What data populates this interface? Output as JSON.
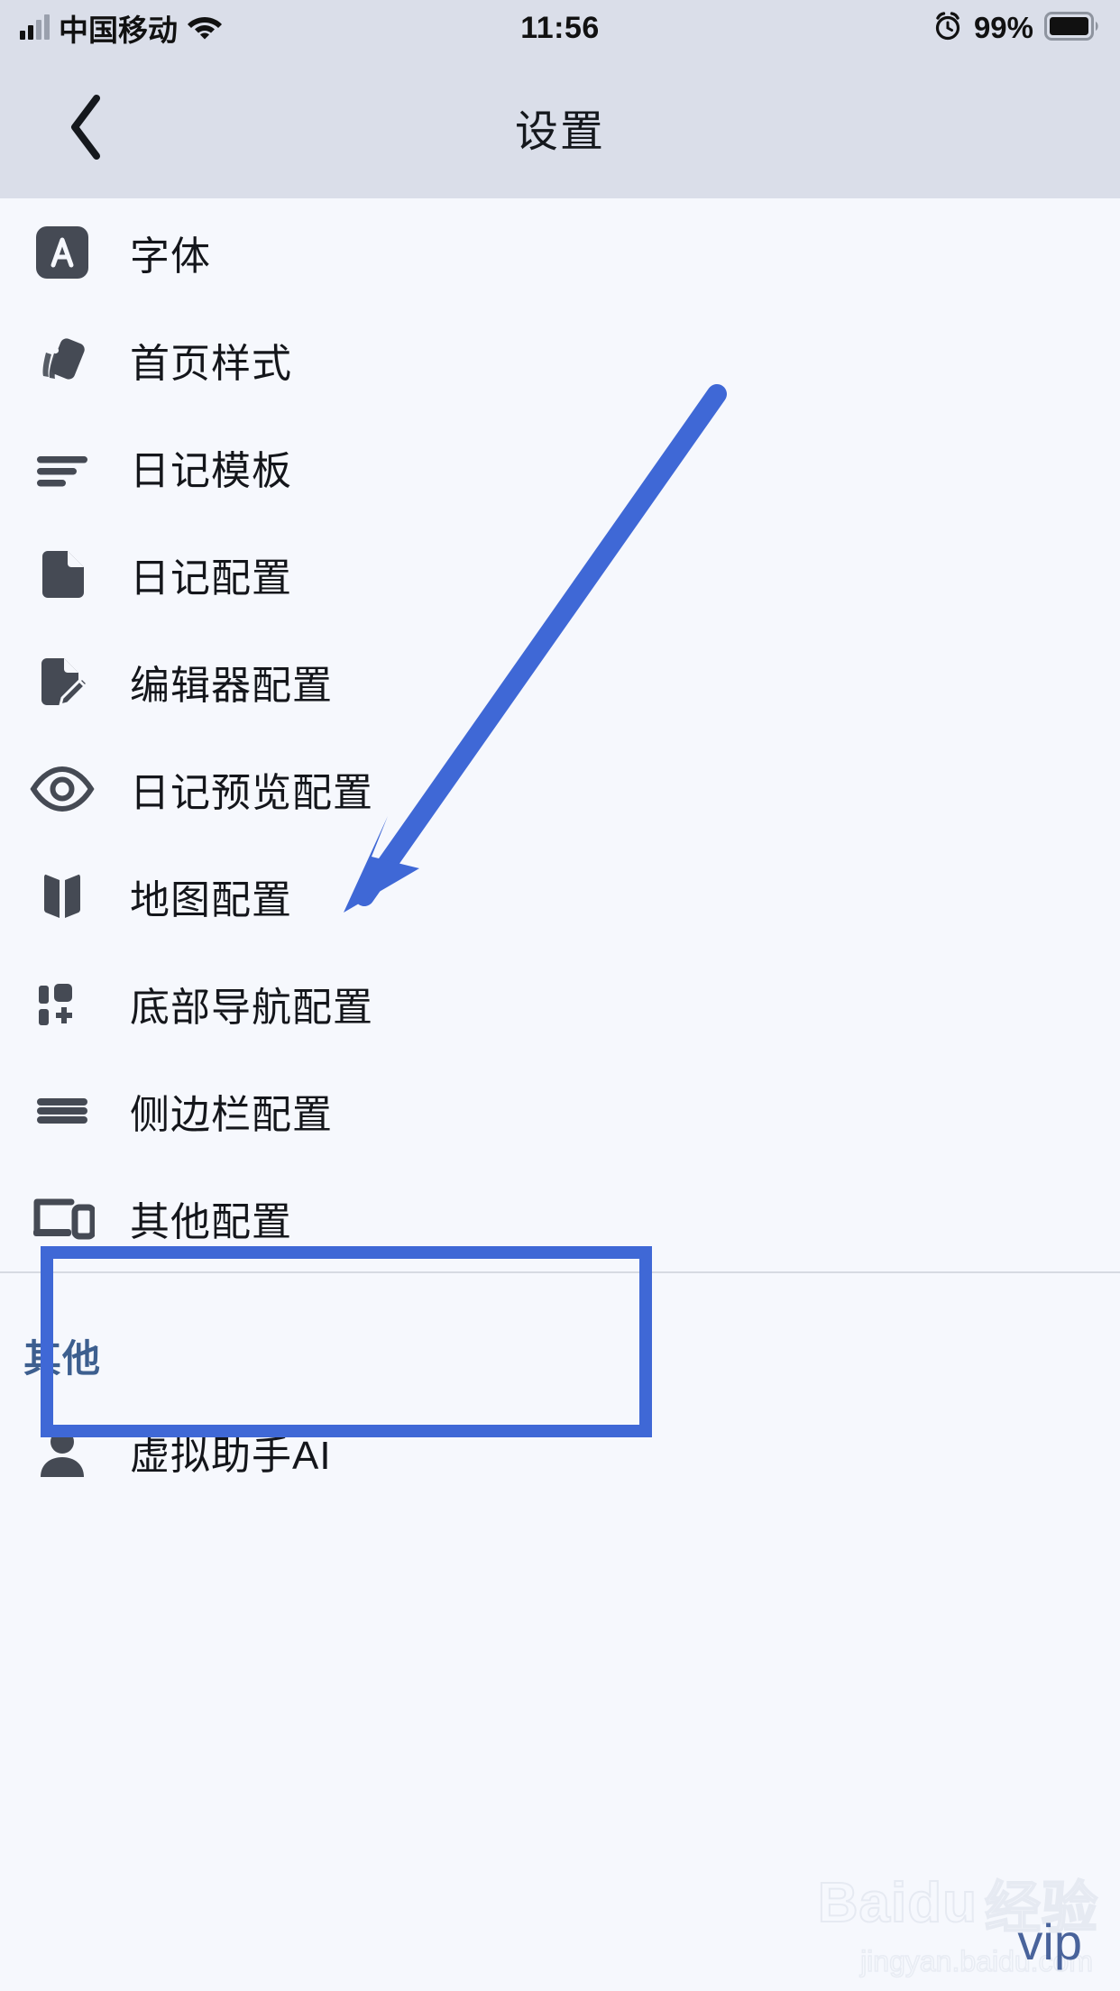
{
  "status_bar": {
    "carrier": "中国移动",
    "time": "11:56",
    "battery_percent": "99%",
    "wifi_icon": "wifi-icon",
    "alarm_icon": "alarm-icon",
    "signal_icon": "signal-bars-icon",
    "battery_icon": "battery-icon"
  },
  "header": {
    "title": "设置",
    "back_icon": "chevron-left-icon"
  },
  "list": {
    "items": [
      {
        "label": "字体",
        "icon": "font-letter-a-icon"
      },
      {
        "label": "首页样式",
        "icon": "cards-style-icon"
      },
      {
        "label": "日记模板",
        "icon": "align-left-lines-icon"
      },
      {
        "label": "日记配置",
        "icon": "document-icon"
      },
      {
        "label": "编辑器配置",
        "icon": "document-pencil-icon"
      },
      {
        "label": "日记预览配置",
        "icon": "eye-icon"
      },
      {
        "label": "地图配置",
        "icon": "map-icon"
      },
      {
        "label": "底部导航配置",
        "icon": "grid-plus-icon"
      },
      {
        "label": "侧边栏配置",
        "icon": "hamburger-menu-icon"
      },
      {
        "label": "其他配置",
        "icon": "laptop-phone-icon"
      }
    ]
  },
  "other_section": {
    "title": "其他",
    "items": [
      {
        "label": "虚拟助手AI",
        "icon": "person-icon"
      }
    ]
  },
  "annotations": {
    "highlight_color": "#3f68d6",
    "highlighted_item": "底部导航配置",
    "arrow_icon": "arrow-pointer-icon"
  },
  "watermark": {
    "brand": "Baidu",
    "brand_cn": "经验",
    "url": "jingyan.baidu.com",
    "badge": "vip"
  },
  "colors": {
    "page_bg": "#f6f8fd",
    "bar_bg": "#dadee9",
    "icon": "#454a54",
    "text": "#14161b",
    "section_title": "#3d5f8f",
    "accent": "#3f68d6"
  }
}
